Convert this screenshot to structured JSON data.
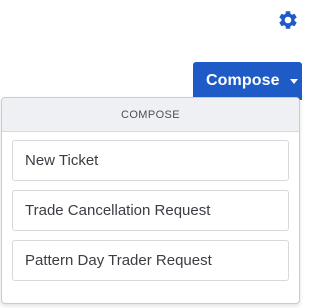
{
  "toolbar": {
    "settings_icon": "gear-icon",
    "settings_color": "#1f5bc6"
  },
  "compose_button": {
    "label": "Compose",
    "caret_icon": "caret-down-icon",
    "color": "#1f5bc6"
  },
  "compose_menu": {
    "header": "COMPOSE",
    "items": [
      {
        "label": "New Ticket"
      },
      {
        "label": "Trade Cancellation Request"
      },
      {
        "label": "Pattern Day Trader Request"
      }
    ]
  }
}
